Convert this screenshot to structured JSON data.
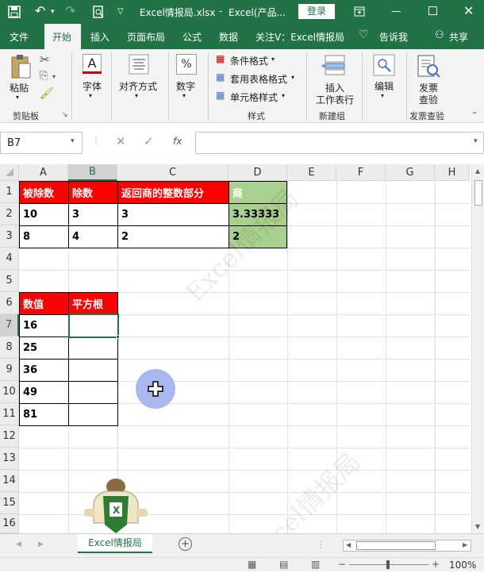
{
  "title": {
    "save_icon": "save-icon",
    "filename": "Excel情报局.xlsx",
    "dash": "-",
    "app": "Excel(产品...",
    "login": "登录"
  },
  "menu": {
    "items": [
      "文件",
      "开始",
      "插入",
      "页面布局",
      "公式",
      "数据",
      "关注V：Excel情报局"
    ],
    "tell": "告诉我",
    "share": "共享"
  },
  "ribbon": {
    "paste": "粘贴",
    "clipboard": "剪贴板",
    "font": "字体",
    "align": "对齐方式",
    "number": "数字",
    "cond_format": "条件格式",
    "table_format": "套用表格格式",
    "cell_style": "单元格样式",
    "styles": "样式",
    "insert_row": "插入",
    "insert_row2": "工作表行",
    "new_group": "新建组",
    "edit": "编辑",
    "invoice1": "发票",
    "invoice2": "查验",
    "invoice_group": "发票查验"
  },
  "formula": {
    "namebox": "B7",
    "fx": "fx",
    "value": ""
  },
  "columns": [
    "A",
    "B",
    "C",
    "D",
    "E",
    "F",
    "G",
    "H"
  ],
  "rows": [
    "1",
    "2",
    "3",
    "4",
    "5",
    "6",
    "7",
    "8",
    "9",
    "10",
    "11",
    "12",
    "13",
    "14",
    "15",
    "16"
  ],
  "table1": {
    "headers": [
      "被除数",
      "除数",
      "返回商的整数部分",
      "商"
    ],
    "rows": [
      [
        "10",
        "3",
        "3",
        "3.33333"
      ],
      [
        "8",
        "4",
        "2",
        "2"
      ]
    ]
  },
  "table2": {
    "headers": [
      "数值",
      "平方根"
    ],
    "rows": [
      [
        "16",
        ""
      ],
      [
        "25",
        ""
      ],
      [
        "36",
        ""
      ],
      [
        "49",
        ""
      ],
      [
        "81",
        ""
      ]
    ]
  },
  "watermark": "Excel情报局",
  "sheet_tab": "Excel情报局",
  "zoom": "100%",
  "colors": {
    "green": "#217346",
    "red": "#ff0000",
    "lightgreen": "#a9d08e"
  }
}
